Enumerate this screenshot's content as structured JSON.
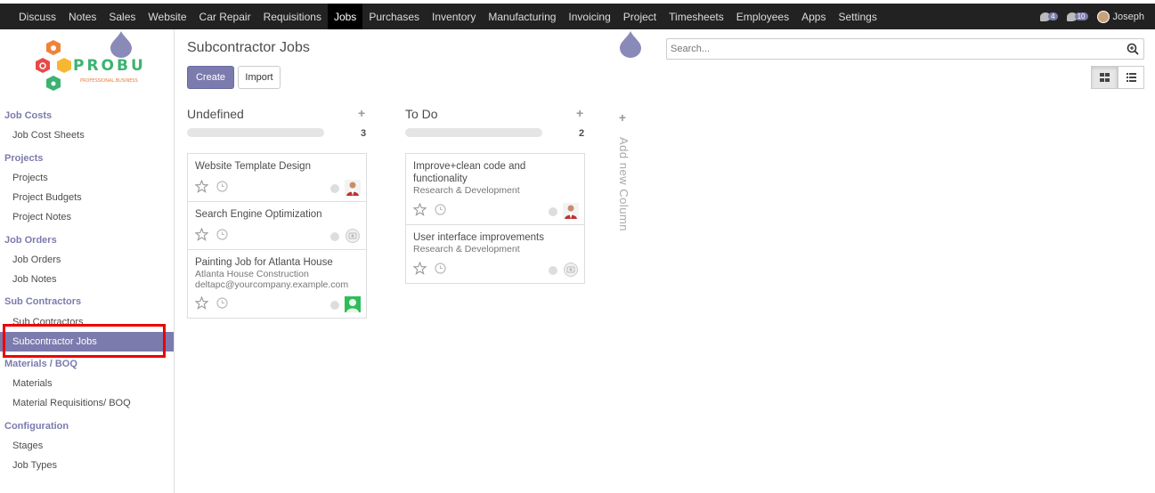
{
  "topnav": {
    "items": [
      "Discuss",
      "Notes",
      "Sales",
      "Website",
      "Car Repair",
      "Requisitions",
      "Jobs",
      "Purchases",
      "Inventory",
      "Manufacturing",
      "Invoicing",
      "Project",
      "Timesheets",
      "Employees",
      "Apps",
      "Settings"
    ],
    "active": "Jobs",
    "chat_count": "4",
    "messages_count": "10",
    "user_name": "Joseph"
  },
  "logo": {
    "brand": "PROBUSE",
    "tagline": "PROFESSIONAL BUSINESS"
  },
  "sidebar": {
    "sections": [
      {
        "title": "Job Costs",
        "items": [
          "Job Cost Sheets"
        ]
      },
      {
        "title": "Projects",
        "items": [
          "Projects",
          "Project Budgets",
          "Project Notes"
        ]
      },
      {
        "title": "Job Orders",
        "items": [
          "Job Orders",
          "Job Notes"
        ]
      },
      {
        "title": "Sub Contractors",
        "items": [
          "Sub Contractors",
          "Subcontractor Jobs"
        ]
      },
      {
        "title": "Materials / BOQ",
        "items": [
          "Materials",
          "Material Requisitions/ BOQ"
        ]
      },
      {
        "title": "Configuration",
        "items": [
          "Stages",
          "Job Types"
        ]
      }
    ],
    "active_item": "Subcontractor Jobs"
  },
  "page": {
    "title": "Subcontractor Jobs",
    "create_label": "Create",
    "import_label": "Import",
    "search_placeholder": "Search..."
  },
  "kanban": {
    "columns": [
      {
        "title": "Undefined",
        "count": "3",
        "cards": [
          {
            "title": "Website Template Design",
            "avatar": "photo"
          },
          {
            "title": "Search Engine Optimization",
            "avatar": "placeholder"
          },
          {
            "title": "Painting Job for Atlanta House",
            "subtitle": "Atlanta House Construction",
            "email": "deltapc@yourcompany.example.com",
            "avatar": "green"
          }
        ]
      },
      {
        "title": "To Do",
        "count": "2",
        "cards": [
          {
            "title": "Improve+clean code and functionality",
            "subtitle": "Research & Development",
            "avatar": "photo"
          },
          {
            "title": "User interface improvements",
            "subtitle": "Research & Development",
            "avatar": "placeholder"
          }
        ]
      }
    ],
    "add_column_label": "Add new Column"
  },
  "colors": {
    "topbar": "#222222",
    "accent": "#7c7bad",
    "highlight_box": "#ee0000"
  }
}
